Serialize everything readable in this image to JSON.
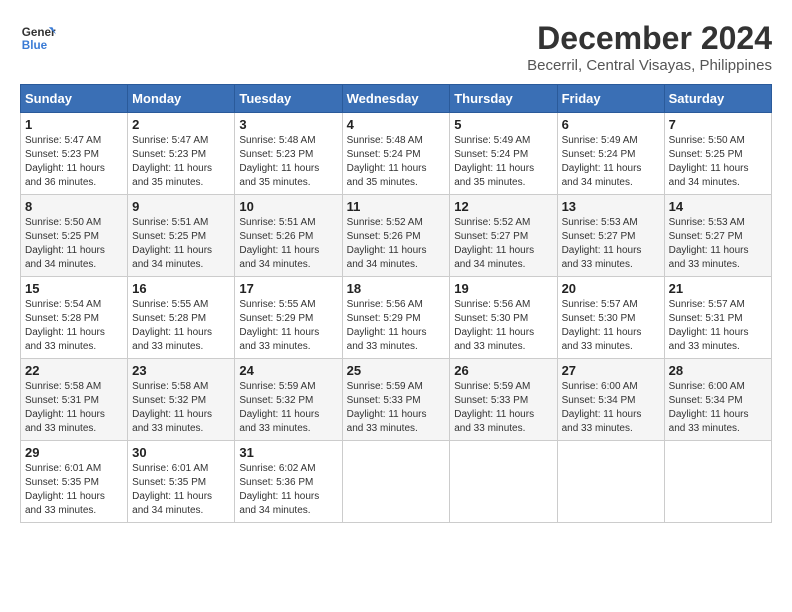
{
  "logo": {
    "text_line1": "General",
    "text_line2": "Blue"
  },
  "title": "December 2024",
  "subtitle": "Becerril, Central Visayas, Philippines",
  "weekdays": [
    "Sunday",
    "Monday",
    "Tuesday",
    "Wednesday",
    "Thursday",
    "Friday",
    "Saturday"
  ],
  "weeks": [
    [
      {
        "day": "1",
        "sunrise": "5:47 AM",
        "sunset": "5:23 PM",
        "daylight": "11 hours and 36 minutes."
      },
      {
        "day": "2",
        "sunrise": "5:47 AM",
        "sunset": "5:23 PM",
        "daylight": "11 hours and 35 minutes."
      },
      {
        "day": "3",
        "sunrise": "5:48 AM",
        "sunset": "5:23 PM",
        "daylight": "11 hours and 35 minutes."
      },
      {
        "day": "4",
        "sunrise": "5:48 AM",
        "sunset": "5:24 PM",
        "daylight": "11 hours and 35 minutes."
      },
      {
        "day": "5",
        "sunrise": "5:49 AM",
        "sunset": "5:24 PM",
        "daylight": "11 hours and 35 minutes."
      },
      {
        "day": "6",
        "sunrise": "5:49 AM",
        "sunset": "5:24 PM",
        "daylight": "11 hours and 34 minutes."
      },
      {
        "day": "7",
        "sunrise": "5:50 AM",
        "sunset": "5:25 PM",
        "daylight": "11 hours and 34 minutes."
      }
    ],
    [
      {
        "day": "8",
        "sunrise": "5:50 AM",
        "sunset": "5:25 PM",
        "daylight": "11 hours and 34 minutes."
      },
      {
        "day": "9",
        "sunrise": "5:51 AM",
        "sunset": "5:25 PM",
        "daylight": "11 hours and 34 minutes."
      },
      {
        "day": "10",
        "sunrise": "5:51 AM",
        "sunset": "5:26 PM",
        "daylight": "11 hours and 34 minutes."
      },
      {
        "day": "11",
        "sunrise": "5:52 AM",
        "sunset": "5:26 PM",
        "daylight": "11 hours and 34 minutes."
      },
      {
        "day": "12",
        "sunrise": "5:52 AM",
        "sunset": "5:27 PM",
        "daylight": "11 hours and 34 minutes."
      },
      {
        "day": "13",
        "sunrise": "5:53 AM",
        "sunset": "5:27 PM",
        "daylight": "11 hours and 33 minutes."
      },
      {
        "day": "14",
        "sunrise": "5:53 AM",
        "sunset": "5:27 PM",
        "daylight": "11 hours and 33 minutes."
      }
    ],
    [
      {
        "day": "15",
        "sunrise": "5:54 AM",
        "sunset": "5:28 PM",
        "daylight": "11 hours and 33 minutes."
      },
      {
        "day": "16",
        "sunrise": "5:55 AM",
        "sunset": "5:28 PM",
        "daylight": "11 hours and 33 minutes."
      },
      {
        "day": "17",
        "sunrise": "5:55 AM",
        "sunset": "5:29 PM",
        "daylight": "11 hours and 33 minutes."
      },
      {
        "day": "18",
        "sunrise": "5:56 AM",
        "sunset": "5:29 PM",
        "daylight": "11 hours and 33 minutes."
      },
      {
        "day": "19",
        "sunrise": "5:56 AM",
        "sunset": "5:30 PM",
        "daylight": "11 hours and 33 minutes."
      },
      {
        "day": "20",
        "sunrise": "5:57 AM",
        "sunset": "5:30 PM",
        "daylight": "11 hours and 33 minutes."
      },
      {
        "day": "21",
        "sunrise": "5:57 AM",
        "sunset": "5:31 PM",
        "daylight": "11 hours and 33 minutes."
      }
    ],
    [
      {
        "day": "22",
        "sunrise": "5:58 AM",
        "sunset": "5:31 PM",
        "daylight": "11 hours and 33 minutes."
      },
      {
        "day": "23",
        "sunrise": "5:58 AM",
        "sunset": "5:32 PM",
        "daylight": "11 hours and 33 minutes."
      },
      {
        "day": "24",
        "sunrise": "5:59 AM",
        "sunset": "5:32 PM",
        "daylight": "11 hours and 33 minutes."
      },
      {
        "day": "25",
        "sunrise": "5:59 AM",
        "sunset": "5:33 PM",
        "daylight": "11 hours and 33 minutes."
      },
      {
        "day": "26",
        "sunrise": "5:59 AM",
        "sunset": "5:33 PM",
        "daylight": "11 hours and 33 minutes."
      },
      {
        "day": "27",
        "sunrise": "6:00 AM",
        "sunset": "5:34 PM",
        "daylight": "11 hours and 33 minutes."
      },
      {
        "day": "28",
        "sunrise": "6:00 AM",
        "sunset": "5:34 PM",
        "daylight": "11 hours and 33 minutes."
      }
    ],
    [
      {
        "day": "29",
        "sunrise": "6:01 AM",
        "sunset": "5:35 PM",
        "daylight": "11 hours and 33 minutes."
      },
      {
        "day": "30",
        "sunrise": "6:01 AM",
        "sunset": "5:35 PM",
        "daylight": "11 hours and 34 minutes."
      },
      {
        "day": "31",
        "sunrise": "6:02 AM",
        "sunset": "5:36 PM",
        "daylight": "11 hours and 34 minutes."
      },
      null,
      null,
      null,
      null
    ]
  ],
  "labels": {
    "sunrise": "Sunrise:",
    "sunset": "Sunset:",
    "daylight": "Daylight:"
  }
}
